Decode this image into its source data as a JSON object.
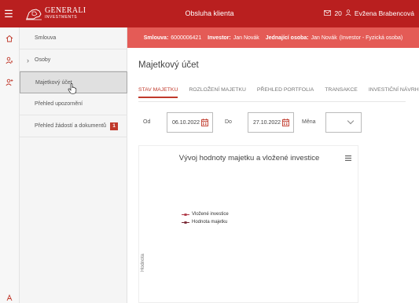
{
  "header": {
    "brand_main": "GENERALI",
    "brand_sub": "INVESTMENTS",
    "title": "Obsluha klienta",
    "messages_count": "20",
    "user_name": "Evžena Brabencová"
  },
  "infostrip": {
    "contract_label": "Smlouva:",
    "contract_value": "6000006421",
    "investor_label": "Investor:",
    "investor_value": "Jan Novák",
    "acting_label": "Jednající osoba:",
    "acting_value": "Jan Novák",
    "acting_role": "(Investor - Fyzická osoba)"
  },
  "sidebar": {
    "items": [
      {
        "label": "Smlouva"
      },
      {
        "label": "Osoby"
      },
      {
        "label": "Majetkový účet"
      },
      {
        "label": "Přehled upozornění"
      },
      {
        "label": "Přehled žádostí a dokumentů",
        "badge": "1"
      }
    ]
  },
  "main": {
    "page_title": "Majetkový účet",
    "tabs": [
      {
        "label": "STAV MAJETKU"
      },
      {
        "label": "ROZLOŽENÍ MAJETKU"
      },
      {
        "label": "PŘEHLED PORTFOLIA"
      },
      {
        "label": "TRANSAKCE"
      },
      {
        "label": "INVESTIČNÍ NÁVRHY"
      }
    ],
    "filters": {
      "from_label": "Od",
      "from_value": "06.10.2022",
      "to_label": "Do",
      "to_value": "27.10.2022",
      "currency_label": "Měna",
      "currency_value": ""
    },
    "chart": {
      "title": "Vývoj hodnoty majetku a vložené investice",
      "y_label": "Hodnota",
      "legend": [
        {
          "name": "Vložené investice",
          "color": "#b03a48"
        },
        {
          "name": "Hodnota majetku",
          "color": "#7a2a36"
        }
      ]
    }
  },
  "colors": {
    "brand_red": "#b91f1f",
    "strip_red": "#e45b56",
    "accent": "#c0392b"
  }
}
